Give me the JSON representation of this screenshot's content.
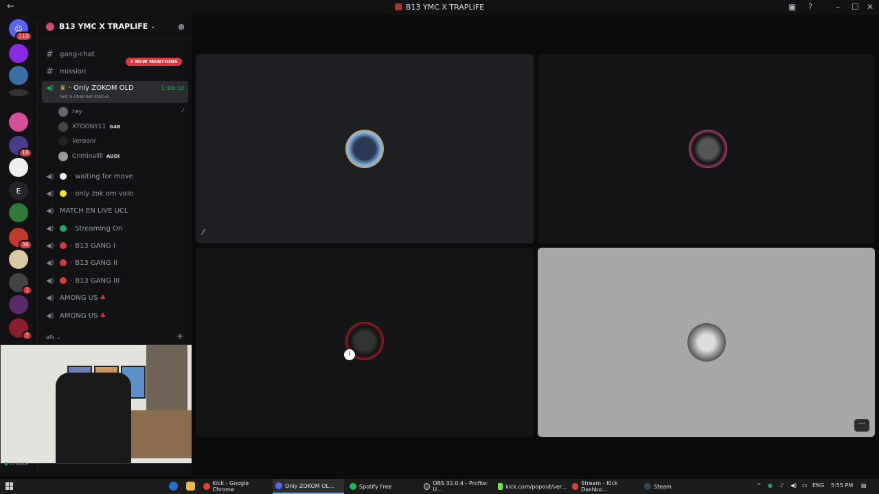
{
  "window": {
    "title": "B13 YMC X TRAPLIFE"
  },
  "guilds": [
    {
      "name": "guild-1",
      "badge": "110",
      "color": "#5865f2"
    },
    {
      "name": "guild-2",
      "badge": "",
      "color": "#8a2be2"
    },
    {
      "name": "guild-3",
      "badge": "",
      "color": "#3a6ea5"
    },
    {
      "name": "guild-4",
      "badge": "",
      "color": "#333333"
    },
    {
      "name": "guild-5",
      "badge": "",
      "color": "#d64d9a"
    },
    {
      "name": "guild-6",
      "badge": "18",
      "color": "#4a3a8a"
    },
    {
      "name": "guild-7",
      "badge": "",
      "color": "#eeeeee"
    },
    {
      "name": "guild-8",
      "letter": "E",
      "badge": "",
      "color": "#232428"
    },
    {
      "name": "guild-9",
      "badge": "",
      "color": "#2f7a3a"
    },
    {
      "name": "guild-10",
      "badge": "36",
      "color": "#c0392b"
    },
    {
      "name": "guild-11",
      "badge": "",
      "color": "#d9c9a3"
    },
    {
      "name": "guild-12",
      "badge": "1",
      "color": "#444444"
    },
    {
      "name": "guild-13",
      "badge": "",
      "color": "#5a2a6a"
    },
    {
      "name": "guild-14",
      "badge": "7",
      "color": "#8b1e2d"
    }
  ],
  "server": {
    "name": "B13 YMC X TRAPLIFE"
  },
  "mentions_pill": "7 NEW MENTIONS",
  "channels": {
    "text": [
      {
        "label": "gang-chat"
      },
      {
        "label": "mission"
      }
    ],
    "active_voice": {
      "label": "Only ZOKOM OLD",
      "timer": "1:08:13",
      "status": "Set a channel status",
      "members": [
        {
          "name": "ray",
          "tag": ""
        },
        {
          "name": "XTOONY11",
          "tag": "G4B"
        },
        {
          "name": "Verooni",
          "tag": ""
        },
        {
          "name": "Criminallll",
          "tag": "AUDI"
        }
      ]
    },
    "voice": [
      {
        "label": "waiting for move",
        "dot": "#f2f3f5"
      },
      {
        "label": "only zok om valo",
        "dot": "#f0e130"
      },
      {
        "label": "MATCH EN LIVE UCL",
        "dot": ""
      },
      {
        "label": "Streaming On",
        "dot": "#23a55a"
      },
      {
        "label": "B13 GANG I",
        "dot": "#da373c"
      },
      {
        "label": "B13 GANG II",
        "dot": "#da373c"
      },
      {
        "label": "B13 GANG III",
        "dot": "#da373c"
      },
      {
        "label": "AMONG US",
        "dot": ""
      },
      {
        "label": "AMONG US",
        "dot": ""
      }
    ],
    "category": "afk"
  },
  "voice_status": "In voice",
  "taskbar": {
    "apps": [
      {
        "label": "Kick - Google Chrome"
      },
      {
        "label": "Only ZOKOM OL..."
      },
      {
        "label": "Spotify Free"
      },
      {
        "label": "OBS 32.0.4 - Profile: U..."
      },
      {
        "label": "kick.com/popout/ver..."
      },
      {
        "label": "Stream - Kick Dashbo..."
      },
      {
        "label": "Steam"
      }
    ],
    "lang": "ENG",
    "time": "5:55 PM"
  },
  "colors": {
    "accent": "#5865f2",
    "danger": "#da373c",
    "online": "#23a55a"
  }
}
